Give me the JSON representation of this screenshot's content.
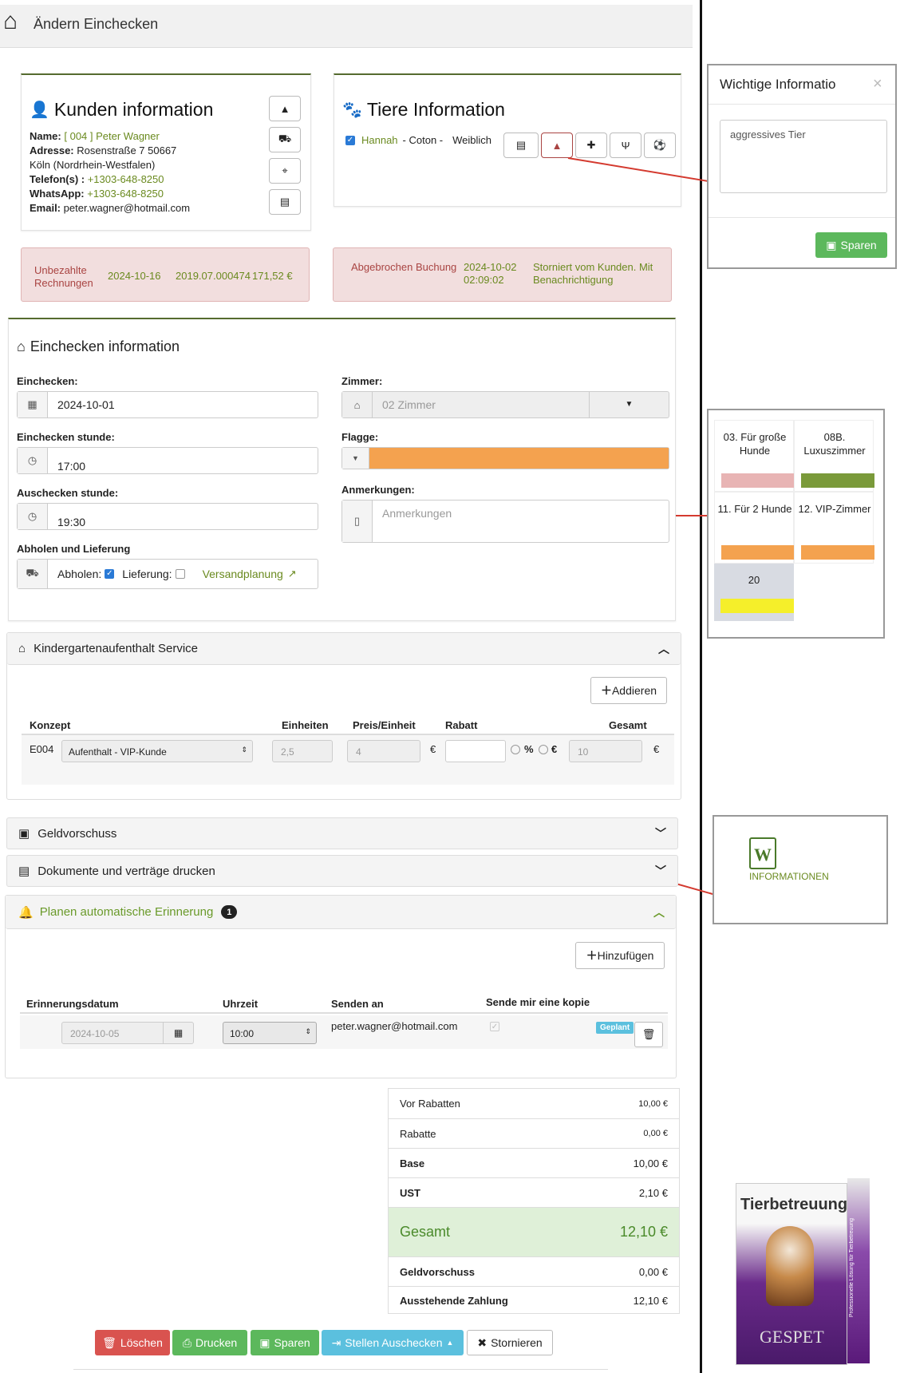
{
  "header": {
    "title": "Ändern Einchecken"
  },
  "customer": {
    "title": "Kunden information",
    "name_label": "Name:",
    "name_value": "[ 004 ] Peter Wagner",
    "address_label": "Adresse:",
    "address_value": "Rosenstraße 7   50667",
    "city": "Köln (Nordrhein-Westfalen)",
    "phone_label": "Telefon(s) :",
    "phone_value": "+1303-648-8250",
    "whatsapp_label": "WhatsApp:",
    "whatsapp_value": "+1303-648-8250",
    "email_label": "Email:",
    "email_value": "peter.wagner@hotmail.com"
  },
  "animals": {
    "title": "Tiere Information",
    "pet_name": "Hannah",
    "pet_breed": "- Coton -",
    "pet_sex": "Weiblich"
  },
  "alerts": {
    "unpaid_label": "Unbezahlte Rechnungen",
    "unpaid_date": "2024-10-16",
    "unpaid_invoice": "2019.07.000474",
    "unpaid_amount": "171,52 €",
    "cancel_label": "Abgebrochen Buchung",
    "cancel_datetime": "2024-10-02 02:09:02",
    "cancel_note": "Storniert vom Kunden. Mit Benachrichtigung"
  },
  "checkin": {
    "title": "Einchecken information",
    "checkin_label": "Einchecken:",
    "checkin_value": "2024-10-01",
    "checkin_hour_label": "Einchecken stunde:",
    "checkin_hour_value": "17:00",
    "checkout_hour_label": "Auschecken stunde:",
    "checkout_hour_value": "19:30",
    "pickup_section": "Abholen und Lieferung",
    "pickup_label": "Abholen:",
    "delivery_label": "Lieferung:",
    "shipping_link": "Versandplanung",
    "room_label": "Zimmer:",
    "room_value": "02 Zimmer",
    "flag_label": "Flagge:",
    "flag_color": "#f4a24f",
    "notes_label": "Anmerkungen:",
    "notes_placeholder": "Anmerkungen"
  },
  "kindergarten": {
    "title": "Kindergartenaufenthalt Service",
    "add_button": "Addieren",
    "columns": [
      "Konzept",
      "Einheiten",
      "Preis/Einheit",
      "Rabatt",
      "Gesamt"
    ],
    "row": {
      "code": "E004",
      "concept": "Aufenthalt - VIP-Kunde",
      "units": "2,5",
      "price": "4",
      "currency": "€",
      "percent": "%",
      "euro": "€",
      "total": "10"
    }
  },
  "sections": {
    "advance": "Geldvorschuss",
    "documents": "Dokumente und verträge drucken"
  },
  "reminder": {
    "title": "Planen automatische Erinnerung",
    "count": "1",
    "add_button": "Hinzufügen",
    "columns": [
      "Erinnerungsdatum",
      "Uhrzeit",
      "Senden an",
      "Sende mir eine kopie"
    ],
    "row": {
      "date": "2024-10-05",
      "time": "10:00",
      "email": "peter.wagner@hotmail.com",
      "status": "Geplant"
    }
  },
  "totals": {
    "rows": [
      {
        "label": "Vor Rabatten",
        "value": "10,00 €"
      },
      {
        "label": "Rabatte",
        "value": "0,00 €"
      },
      {
        "label": "Base",
        "value": "10,00 €"
      },
      {
        "label": "UST",
        "value": "2,10 €"
      }
    ],
    "total_label": "Gesamt",
    "total_value": "12,10 €",
    "advance_label": "Geldvorschuss",
    "advance_value": "0,00 €",
    "pending_label": "Ausstehende Zahlung",
    "pending_value": "12,10 €"
  },
  "actions": {
    "delete": "Löschen",
    "print": "Drucken",
    "save": "Sparen",
    "checkout": "Stellen Auschecken",
    "cancel": "Stornieren"
  },
  "info_popup": {
    "title": "Wichtige Informatio",
    "close": "×",
    "text": "aggressives Tier",
    "save": "Sparen"
  },
  "rooms": [
    {
      "name": "03. Für große Hunde",
      "color": "#e8b4b4"
    },
    {
      "name": "08B. Luxuszimmer",
      "color": "#7a9a3a"
    },
    {
      "name": "11. Für 2 Hunde",
      "color": "#f4a24f"
    },
    {
      "name": "12. VIP-Zimmer",
      "color": "#f4a24f"
    },
    {
      "name": "20",
      "color": "#f5ef2a"
    }
  ],
  "word_box": {
    "label": "INFORMATIONEN"
  },
  "product": {
    "title": "Tierbetreuung",
    "brand": "GESPET",
    "side": "Professionelle Lösung für Tierbetreuung"
  }
}
